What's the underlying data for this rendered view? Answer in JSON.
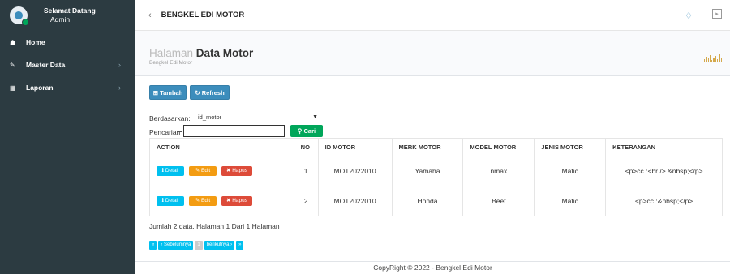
{
  "sidebar": {
    "greeting": "Selamat Datang",
    "role": "Admin",
    "items": [
      {
        "label": "Home",
        "icon": "home-icon"
      },
      {
        "label": "Master Data",
        "icon": "edit-icon"
      },
      {
        "label": "Laporan",
        "icon": "calendar-icon"
      }
    ]
  },
  "header": {
    "brand": "BENGKEL EDI MOTOR"
  },
  "page": {
    "title_light": "Halaman",
    "title_strong": "Data Motor",
    "subtitle": "Bengkel Edi Motor"
  },
  "toolbar": {
    "tambah_label": "Tambah",
    "refresh_label": "Refresh"
  },
  "filter": {
    "label": "Berdasarkan:",
    "selected": "id_motor",
    "search_label": "Pencarian",
    "search_value": "",
    "search_button": "Cari"
  },
  "table": {
    "headers": [
      "ACTION",
      "NO",
      "ID MOTOR",
      "MERK MOTOR",
      "MODEL MOTOR",
      "JENIS MOTOR",
      "KETERANGAN"
    ],
    "action_labels": {
      "detail": "Detail",
      "edit": "Edit",
      "hapus": "Hapus"
    },
    "rows": [
      {
        "no": "1",
        "id_motor": "MOT2022010",
        "merk": "Yamaha",
        "model": "nmax",
        "jenis": "Matic",
        "keterangan": "<p>cc :<br /> &nbsp;</p>"
      },
      {
        "no": "2",
        "id_motor": "MOT2022010",
        "merk": "Honda",
        "model": "Beet",
        "jenis": "Matic",
        "keterangan": "<p>cc :&nbsp;</p>"
      }
    ]
  },
  "summary": "Jumlah 2 data, Halaman 1 Dari 1 Halaman",
  "pager": {
    "first": "«",
    "prev": "‹ Sebelumnya",
    "current": "1",
    "next": "berikutnya ›",
    "last": "»"
  },
  "footer": "CopyRight © 2022 - Bengkel Edi Motor",
  "colors": {
    "sidebar": "#2c3b41",
    "primary": "#3c8dbc",
    "success": "#00a65a",
    "info": "#00c0ef",
    "warning": "#f39c12",
    "danger": "#dd4b39"
  }
}
